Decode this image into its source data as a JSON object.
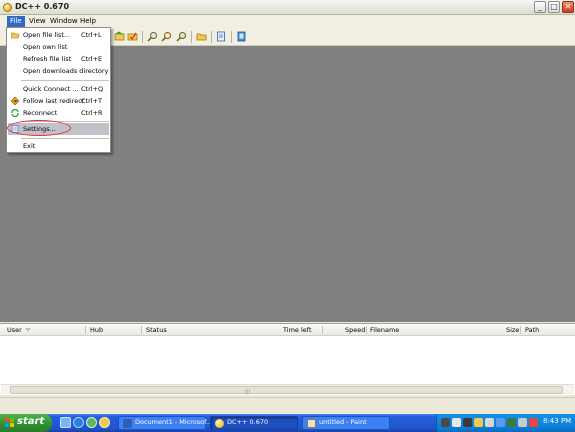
{
  "window": {
    "title": "DC++ 0.670",
    "min_glyph": "_",
    "max_glyph": "□",
    "close_glyph": "✕"
  },
  "menubar": {
    "items": [
      "File",
      "View",
      "Window",
      "Help"
    ]
  },
  "file_menu": {
    "items": [
      {
        "label": "Open file list...",
        "shortcut": "Ctrl+L",
        "icon": "folder-open-icon"
      },
      {
        "label": "Open own list",
        "shortcut": ""
      },
      {
        "label": "Refresh file list",
        "shortcut": "Ctrl+E"
      },
      {
        "label": "Open downloads directory",
        "shortcut": ""
      },
      {
        "label": "Quick Connect ...",
        "shortcut": "Ctrl+Q"
      },
      {
        "label": "Follow last redirect",
        "shortcut": "Ctrl+T",
        "icon": "redirect-icon"
      },
      {
        "label": "Reconnect",
        "shortcut": "Ctrl+R",
        "icon": "reconnect-icon"
      },
      {
        "label": "Settings...",
        "shortcut": "",
        "icon": "settings-icon",
        "highlighted": true
      },
      {
        "label": "Exit",
        "shortcut": ""
      }
    ]
  },
  "transfers": {
    "columns": [
      "User",
      "Hub",
      "Status",
      "Time left",
      "Speed",
      "Filename",
      "Size",
      "Path"
    ],
    "scroll_grip": "|||"
  },
  "taskbar": {
    "start_label": "start",
    "tasks": [
      {
        "label": "Document1 - Microsof...",
        "active": false
      },
      {
        "label": "DC++ 0.670",
        "active": true
      },
      {
        "label": "untitled - Paint",
        "active": false
      }
    ],
    "clock": "8:43 PM"
  },
  "colors": {
    "mdi_background": "#808080",
    "menu_highlight": "#316AC5",
    "annotation_circle": "#E0303A",
    "taskbar_blue": "#245EDB",
    "start_green": "#3C9E3C"
  }
}
